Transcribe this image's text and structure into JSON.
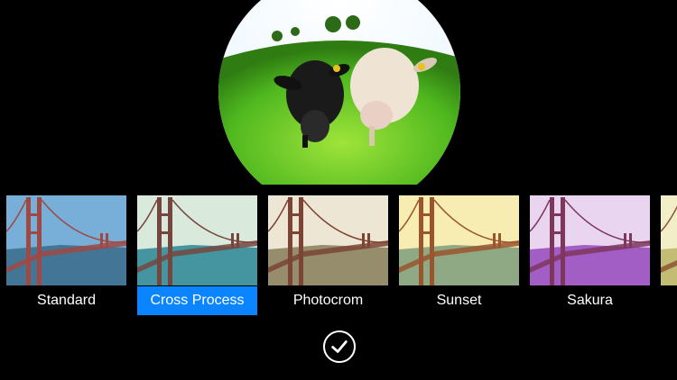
{
  "filters": [
    {
      "label": "Standard",
      "tint": "#5a8fb8",
      "sky": "#7fb6e0",
      "water": "#3e6f8f",
      "tower": "#b0392b",
      "selected": false
    },
    {
      "label": "Cross Process",
      "tint": "#66c7c2",
      "sky": "#f3f1e2",
      "water": "#3f8a9a",
      "tower": "#7a2a22",
      "selected": true
    },
    {
      "label": "Photocrom",
      "tint": "#c9b98b",
      "sky": "#f6f1e4",
      "water": "#8a8466",
      "tower": "#6b2b22",
      "selected": false
    },
    {
      "label": "Sunset",
      "tint": "#e7d36a",
      "sky": "#fbf3c4",
      "water": "#7aa08a",
      "tower": "#8a3a22",
      "selected": false
    },
    {
      "label": "Sakura",
      "tint": "#c77be0",
      "sky": "#f2eaf5",
      "water": "#9a58c0",
      "tower": "#6e2840",
      "selected": false
    },
    {
      "label": "",
      "tint": "#d9d080",
      "sky": "#f8f4d8",
      "water": "#bfb872",
      "tower": "#7a3a22",
      "selected": false
    }
  ],
  "confirm": {
    "icon": "checkmark-icon"
  },
  "preview": {
    "subject": "two sheep fisheye photo"
  }
}
